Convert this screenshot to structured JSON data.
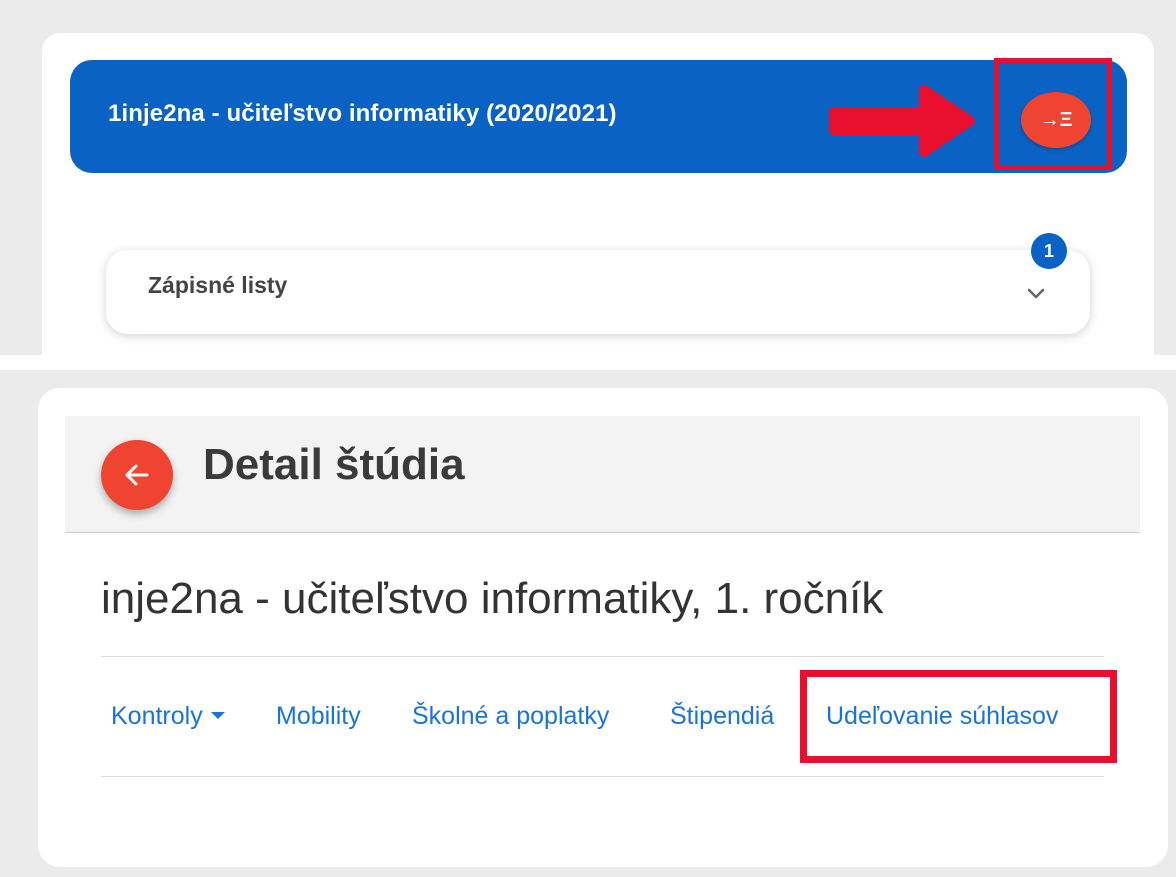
{
  "top": {
    "study_title": "1inje2na - učiteľstvo informatiky (2020/2021)",
    "enter_icon": "→Ξ",
    "enrolment_label": "Zápisné listy",
    "enrolment_count": "1"
  },
  "bottom": {
    "header_title": "Detail štúdia",
    "program_title": "inje2na - učiteľstvo informatiky, 1. ročník",
    "nav": {
      "kontroly": "Kontroly",
      "mobility": "Mobility",
      "skolne": "Školné a poplatky",
      "stipendia": "Štipendiá",
      "suhlasy": "Udeľovanie súhlasov"
    }
  },
  "colors": {
    "primary_blue": "#0a63c4",
    "accent_red": "#f04432",
    "highlight_red": "#e8102e",
    "link_blue": "#1a73d9"
  }
}
